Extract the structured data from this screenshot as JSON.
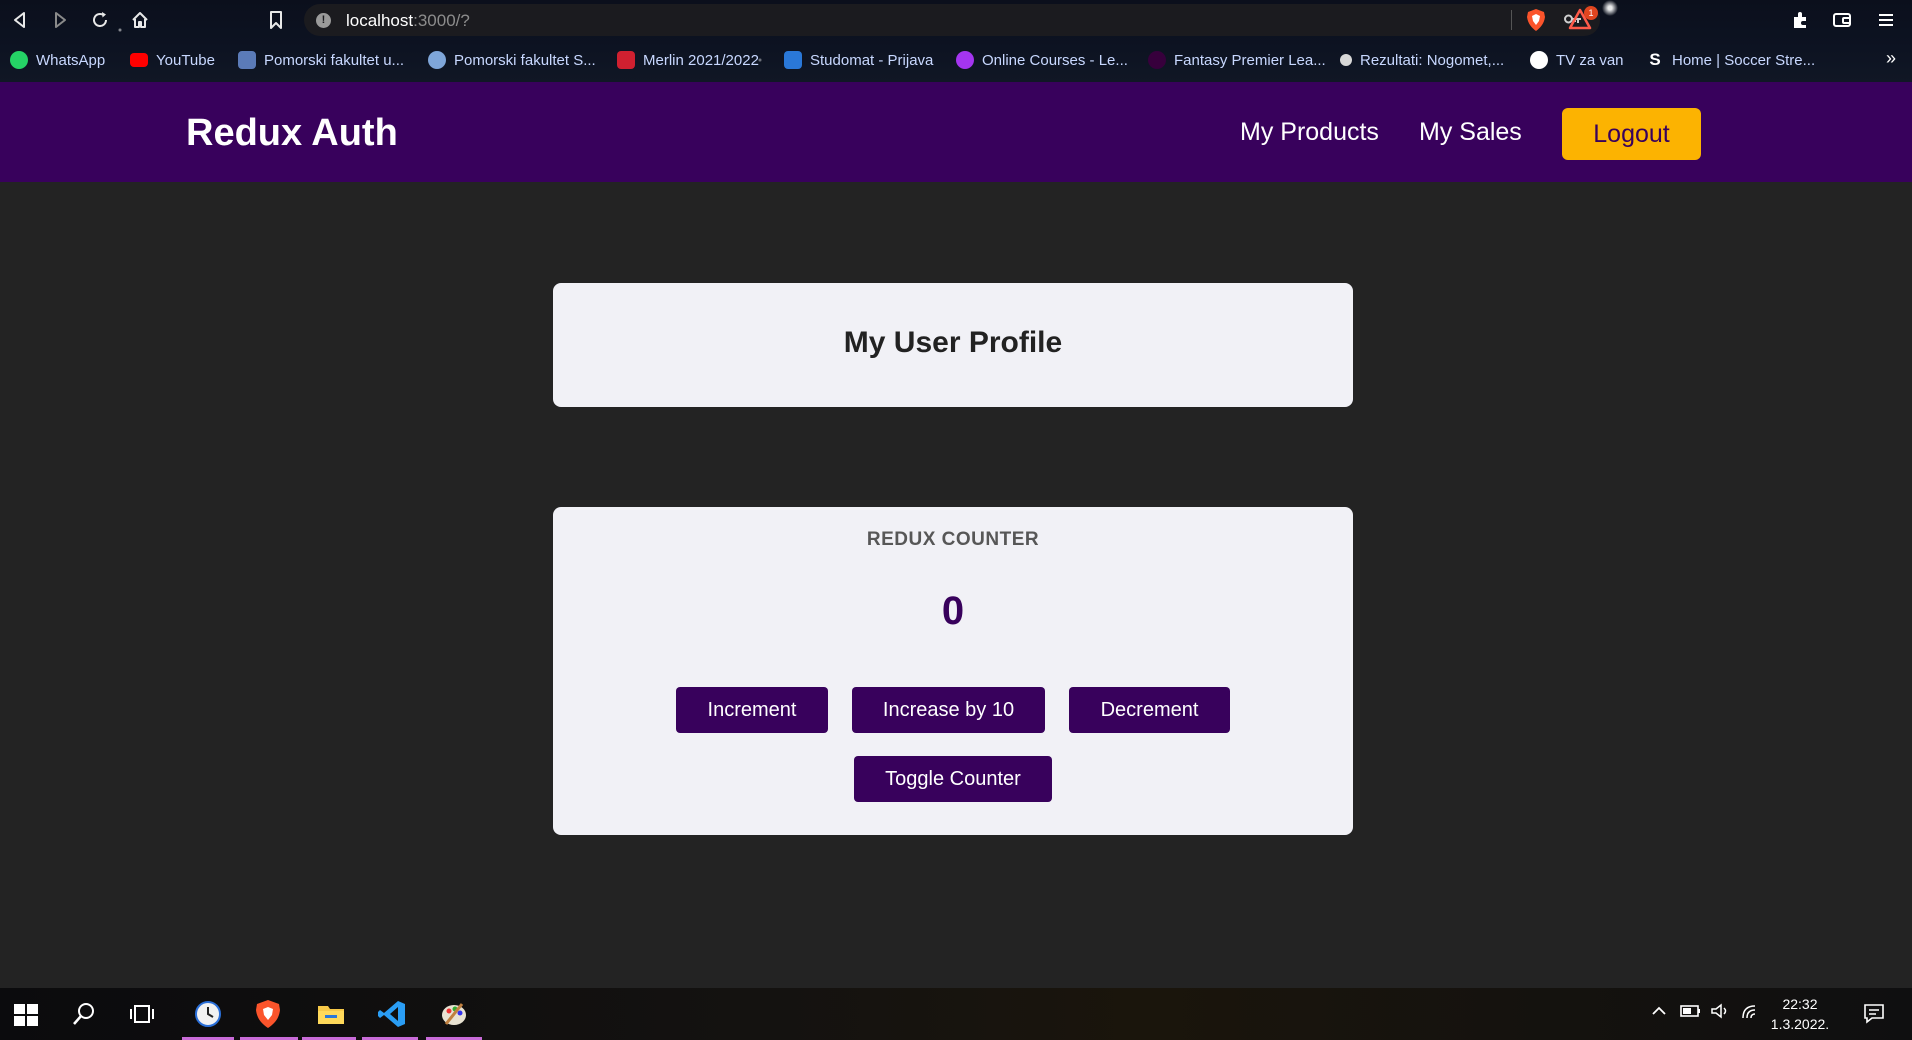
{
  "browser": {
    "url_host": "localhost",
    "url_rest": ":3000/?",
    "bookmarks": [
      {
        "label": "WhatsApp",
        "color": "#25d366"
      },
      {
        "label": "YouTube",
        "color": "#ff0000"
      },
      {
        "label": "Pomorski fakultet u...",
        "color": "#5b7bb8"
      },
      {
        "label": "Pomorski fakultet S...",
        "color": "#7fa6d9"
      },
      {
        "label": "Merlin 2021/2022",
        "color": "#d02030"
      },
      {
        "label": "Studomat - Prijava",
        "color": "#2a78d8"
      },
      {
        "label": "Online Courses - Le...",
        "color": "#a435f0"
      },
      {
        "label": "Fantasy Premier Lea...",
        "color": "#37003c"
      },
      {
        "label": "Rezultati: Nogomet,...",
        "color": "#d8d8d8"
      },
      {
        "label": "TV za van",
        "color": "#ffffff"
      },
      {
        "label": "Home | Soccer Stre...",
        "color": "#ffffff"
      }
    ],
    "bookmarks_more": "»"
  },
  "header": {
    "brand": "Redux Auth",
    "nav": {
      "products": "My Products",
      "sales": "My Sales",
      "logout": "Logout"
    }
  },
  "profile": {
    "title": "My User Profile"
  },
  "counter": {
    "label": "REDUX COUNTER",
    "value": "0",
    "buttons": {
      "increment": "Increment",
      "increase10": "Increase by 10",
      "decrement": "Decrement",
      "toggle": "Toggle Counter"
    }
  },
  "taskbar": {
    "time": "22:32",
    "date": "1.3.2022.",
    "notification_count": "1"
  },
  "colors": {
    "brand": "#38015c",
    "accent": "#fcb301",
    "card": "#f1f1f6",
    "background": "#232323"
  }
}
